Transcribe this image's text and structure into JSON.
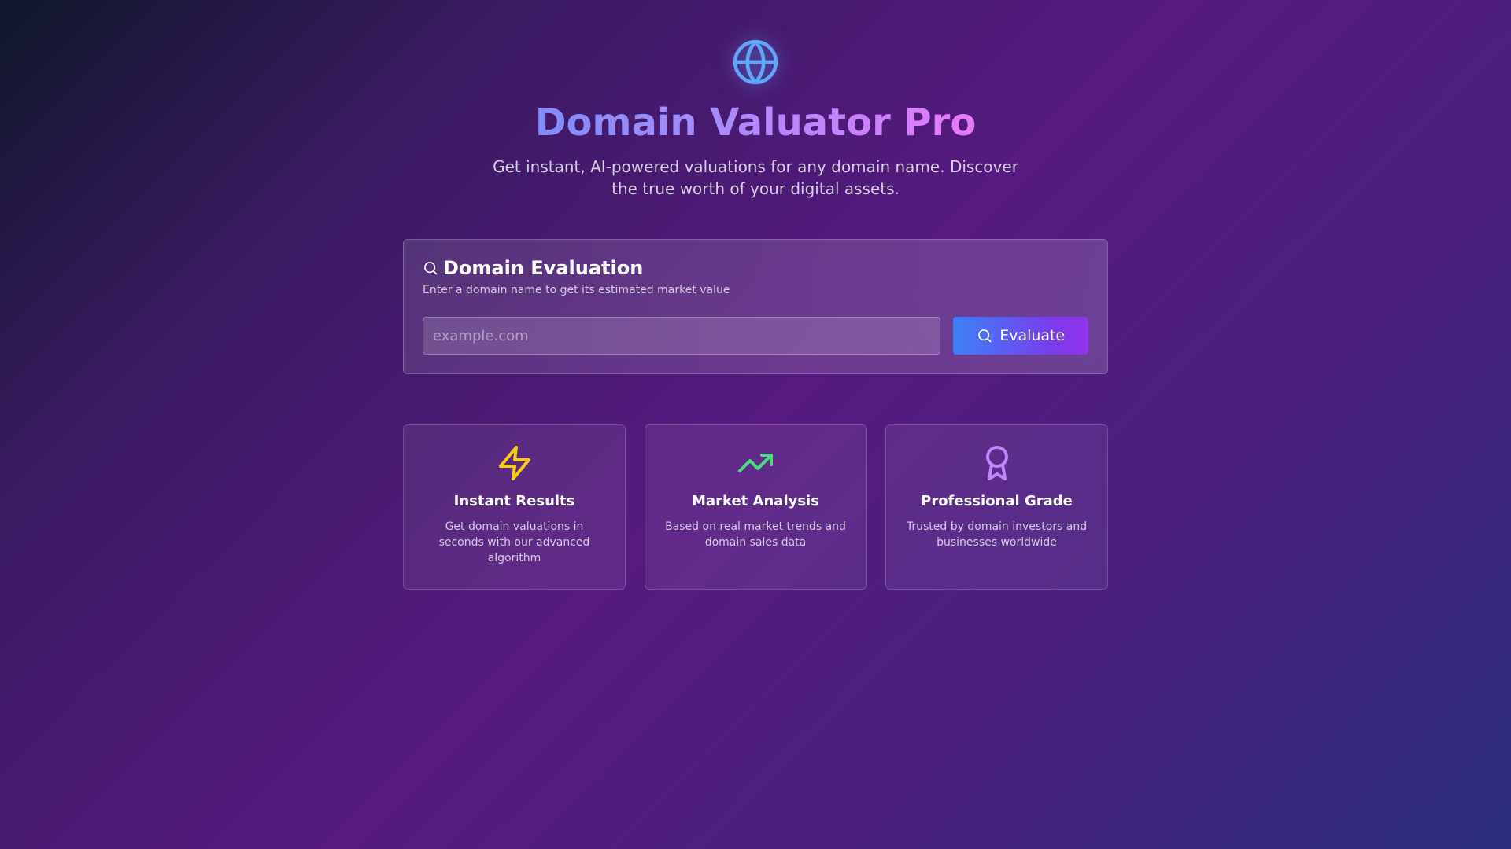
{
  "hero": {
    "icon": "globe-icon",
    "title": "Domain Valuator Pro",
    "subtitle": "Get instant, AI-powered valuations for any domain name. Discover the true worth of your digital assets."
  },
  "evaluation": {
    "icon": "search-icon",
    "title": "Domain Evaluation",
    "description": "Enter a domain name to get its estimated market value",
    "input_value": "",
    "input_placeholder": "example.com",
    "button_label": "Evaluate"
  },
  "features": [
    {
      "icon": "lightning-icon",
      "icon_color": "#facc15",
      "title": "Instant Results",
      "description": "Get domain valuations in seconds with our advanced algorithm"
    },
    {
      "icon": "trending-up-icon",
      "icon_color": "#4ade80",
      "title": "Market Analysis",
      "description": "Based on real market trends and domain sales data"
    },
    {
      "icon": "award-icon",
      "icon_color": "#c084fc",
      "title": "Professional Grade",
      "description": "Trusted by domain investors and businesses worldwide"
    }
  ],
  "colors": {
    "globe": "#60a5fa",
    "button_gradient_start": "#3b82f6",
    "button_gradient_end": "#9333ea"
  }
}
